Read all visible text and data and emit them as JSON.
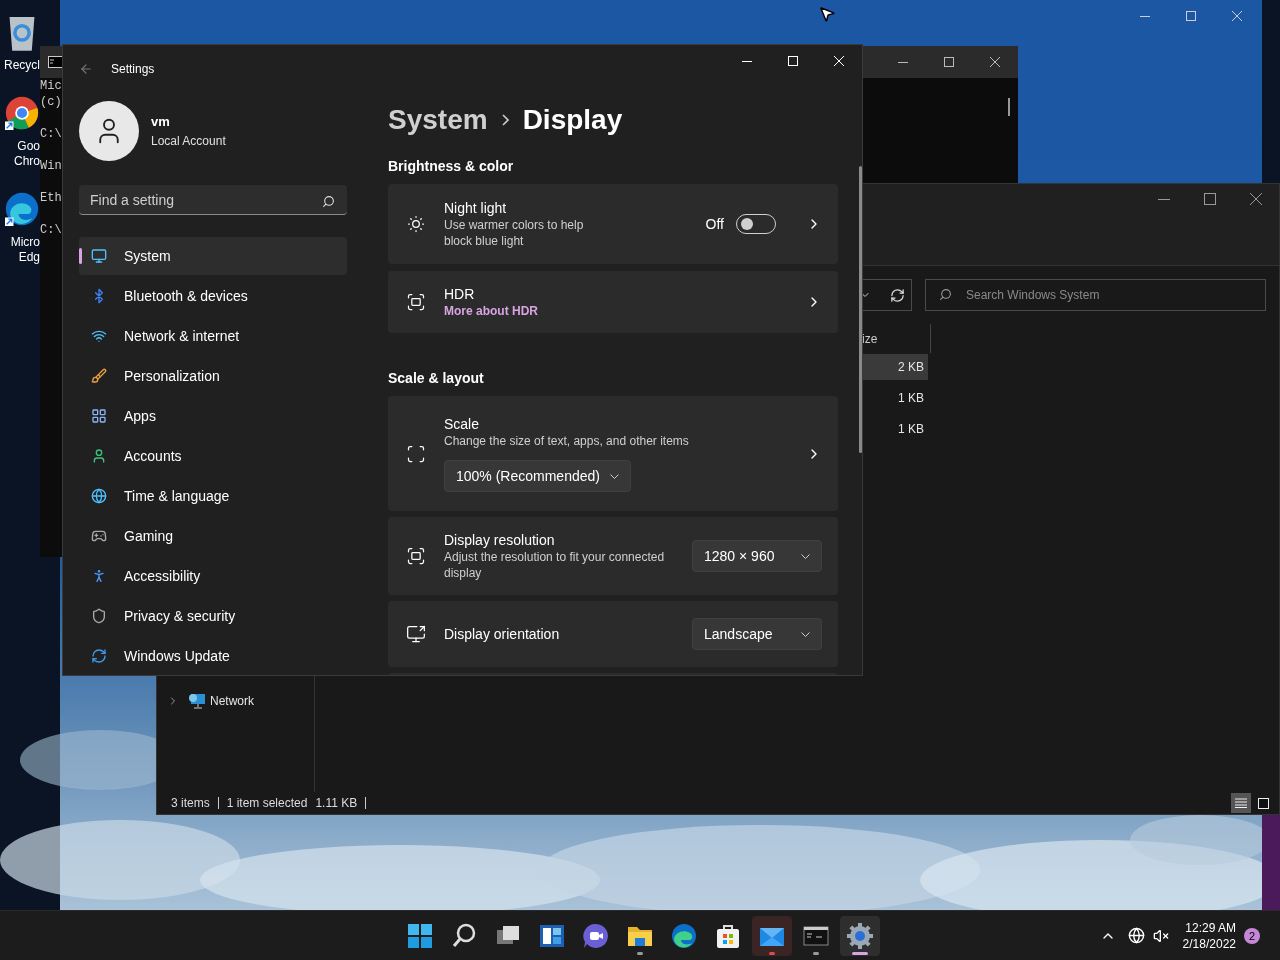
{
  "desktop": {
    "icons": [
      {
        "kind": "recycle-bin",
        "label_lines": [
          "Recycl"
        ]
      },
      {
        "kind": "chrome",
        "label_lines": [
          "Goo",
          "Chro"
        ]
      },
      {
        "kind": "edge",
        "label_lines": [
          "Micro",
          "Edg"
        ]
      }
    ]
  },
  "console": {
    "blocks": [
      [
        "Mic",
        "(c)"
      ],
      [
        "C:\\"
      ],
      [
        "Win"
      ],
      [
        "Eth"
      ],
      [
        "C:\\"
      ]
    ]
  },
  "explorer": {
    "column_header": "ize",
    "sizes": [
      {
        "text": "2 KB",
        "selected": true
      },
      {
        "text": "1 KB",
        "selected": false
      },
      {
        "text": "1 KB",
        "selected": false
      }
    ],
    "search": {
      "placeholder": "Search Windows System"
    },
    "nav_items": [
      {
        "label": "Network",
        "expanded": false
      }
    ],
    "status_bar": {
      "items": "3 items",
      "selection": "1 item selected",
      "size": "1.11 KB"
    },
    "view_modes": [
      {
        "kind": "details",
        "selected": true
      },
      {
        "kind": "thumbnails",
        "selected": false
      }
    ]
  },
  "settings": {
    "title": "Settings",
    "user": {
      "name": "vm",
      "account": "Local Account"
    },
    "search": {
      "placeholder": "Find a setting"
    },
    "nav": [
      {
        "kind": "system",
        "label": "System",
        "selected": true
      },
      {
        "kind": "bluetooth",
        "label": "Bluetooth & devices",
        "selected": false
      },
      {
        "kind": "network",
        "label": "Network & internet",
        "selected": false
      },
      {
        "kind": "personalization",
        "label": "Personalization",
        "selected": false
      },
      {
        "kind": "apps",
        "label": "Apps",
        "selected": false
      },
      {
        "kind": "accounts",
        "label": "Accounts",
        "selected": false
      },
      {
        "kind": "time",
        "label": "Time & language",
        "selected": false
      },
      {
        "kind": "gaming",
        "label": "Gaming",
        "selected": false
      },
      {
        "kind": "accessibility",
        "label": "Accessibility",
        "selected": false
      },
      {
        "kind": "privacy",
        "label": "Privacy & security",
        "selected": false
      },
      {
        "kind": "update",
        "label": "Windows Update",
        "selected": false
      }
    ],
    "breadcrumb": [
      "System",
      "Display"
    ],
    "sections": [
      {
        "heading": "Brightness & color",
        "cards": [
          {
            "kind": "toggle",
            "title": "Night light",
            "description": "Use warmer colors to help block blue light",
            "state_text": "Off",
            "on": false
          },
          {
            "kind": "link",
            "title": "HDR",
            "link": "More about HDR"
          }
        ]
      },
      {
        "heading": "Scale & layout",
        "cards": [
          {
            "kind": "dropdown-below",
            "title": "Scale",
            "description": "Change the size of text, apps, and other items",
            "value": "100% (Recommended)"
          },
          {
            "kind": "dropdown",
            "title": "Display resolution",
            "description": "Adjust the resolution to fit your connected display",
            "value": "1280 × 960"
          },
          {
            "kind": "dropdown",
            "title": "Display orientation",
            "value": "Landscape"
          }
        ]
      }
    ]
  },
  "taskbar": {
    "apps": [
      {
        "kind": "start",
        "running": false,
        "selected": false,
        "attention": false
      },
      {
        "kind": "search",
        "running": false,
        "selected": false,
        "attention": false
      },
      {
        "kind": "taskview",
        "running": false,
        "selected": false,
        "attention": false
      },
      {
        "kind": "widgets",
        "running": false,
        "selected": false,
        "attention": false
      },
      {
        "kind": "chat",
        "running": false,
        "selected": false,
        "attention": false
      },
      {
        "kind": "explorer",
        "running": true,
        "selected": false,
        "attention": false
      },
      {
        "kind": "browser",
        "running": false,
        "selected": false,
        "attention": false
      },
      {
        "kind": "store",
        "running": false,
        "selected": false,
        "attention": false
      },
      {
        "kind": "mail",
        "running": true,
        "selected": false,
        "attention": true
      },
      {
        "kind": "terminal",
        "running": true,
        "selected": false,
        "attention": false
      },
      {
        "kind": "settings",
        "running": true,
        "selected": true,
        "attention": false
      }
    ],
    "tray": {
      "time": "12:29 AM",
      "date": "2/18/2022",
      "notifications": "2"
    }
  }
}
